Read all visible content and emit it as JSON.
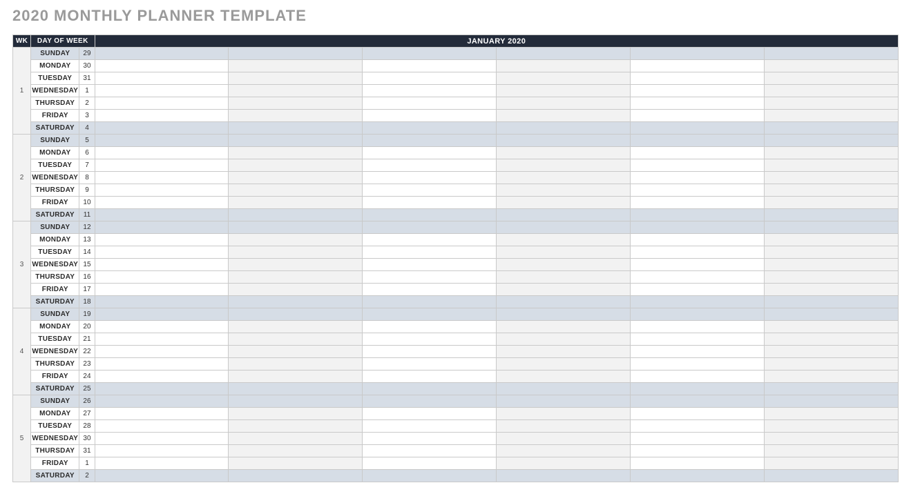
{
  "title": "2020 MONTHLY PLANNER TEMPLATE",
  "headers": {
    "wk": "WK",
    "dow": "DAY OF WEEK",
    "month": "JANUARY 2020"
  },
  "entry_columns": 6,
  "weeks": [
    {
      "number": "1",
      "days": [
        {
          "dow": "SUNDAY",
          "num": "29",
          "weekend": true
        },
        {
          "dow": "MONDAY",
          "num": "30",
          "weekend": false
        },
        {
          "dow": "TUESDAY",
          "num": "31",
          "weekend": false
        },
        {
          "dow": "WEDNESDAY",
          "num": "1",
          "weekend": false
        },
        {
          "dow": "THURSDAY",
          "num": "2",
          "weekend": false
        },
        {
          "dow": "FRIDAY",
          "num": "3",
          "weekend": false
        },
        {
          "dow": "SATURDAY",
          "num": "4",
          "weekend": true
        }
      ]
    },
    {
      "number": "2",
      "days": [
        {
          "dow": "SUNDAY",
          "num": "5",
          "weekend": true
        },
        {
          "dow": "MONDAY",
          "num": "6",
          "weekend": false
        },
        {
          "dow": "TUESDAY",
          "num": "7",
          "weekend": false
        },
        {
          "dow": "WEDNESDAY",
          "num": "8",
          "weekend": false
        },
        {
          "dow": "THURSDAY",
          "num": "9",
          "weekend": false
        },
        {
          "dow": "FRIDAY",
          "num": "10",
          "weekend": false
        },
        {
          "dow": "SATURDAY",
          "num": "11",
          "weekend": true
        }
      ]
    },
    {
      "number": "3",
      "days": [
        {
          "dow": "SUNDAY",
          "num": "12",
          "weekend": true
        },
        {
          "dow": "MONDAY",
          "num": "13",
          "weekend": false
        },
        {
          "dow": "TUESDAY",
          "num": "14",
          "weekend": false
        },
        {
          "dow": "WEDNESDAY",
          "num": "15",
          "weekend": false
        },
        {
          "dow": "THURSDAY",
          "num": "16",
          "weekend": false
        },
        {
          "dow": "FRIDAY",
          "num": "17",
          "weekend": false
        },
        {
          "dow": "SATURDAY",
          "num": "18",
          "weekend": true
        }
      ]
    },
    {
      "number": "4",
      "days": [
        {
          "dow": "SUNDAY",
          "num": "19",
          "weekend": true
        },
        {
          "dow": "MONDAY",
          "num": "20",
          "weekend": false
        },
        {
          "dow": "TUESDAY",
          "num": "21",
          "weekend": false
        },
        {
          "dow": "WEDNESDAY",
          "num": "22",
          "weekend": false
        },
        {
          "dow": "THURSDAY",
          "num": "23",
          "weekend": false
        },
        {
          "dow": "FRIDAY",
          "num": "24",
          "weekend": false
        },
        {
          "dow": "SATURDAY",
          "num": "25",
          "weekend": true
        }
      ]
    },
    {
      "number": "5",
      "days": [
        {
          "dow": "SUNDAY",
          "num": "26",
          "weekend": true
        },
        {
          "dow": "MONDAY",
          "num": "27",
          "weekend": false
        },
        {
          "dow": "TUESDAY",
          "num": "28",
          "weekend": false
        },
        {
          "dow": "WEDNESDAY",
          "num": "30",
          "weekend": false
        },
        {
          "dow": "THURSDAY",
          "num": "31",
          "weekend": false
        },
        {
          "dow": "FRIDAY",
          "num": "1",
          "weekend": false
        },
        {
          "dow": "SATURDAY",
          "num": "2",
          "weekend": true
        }
      ]
    }
  ]
}
